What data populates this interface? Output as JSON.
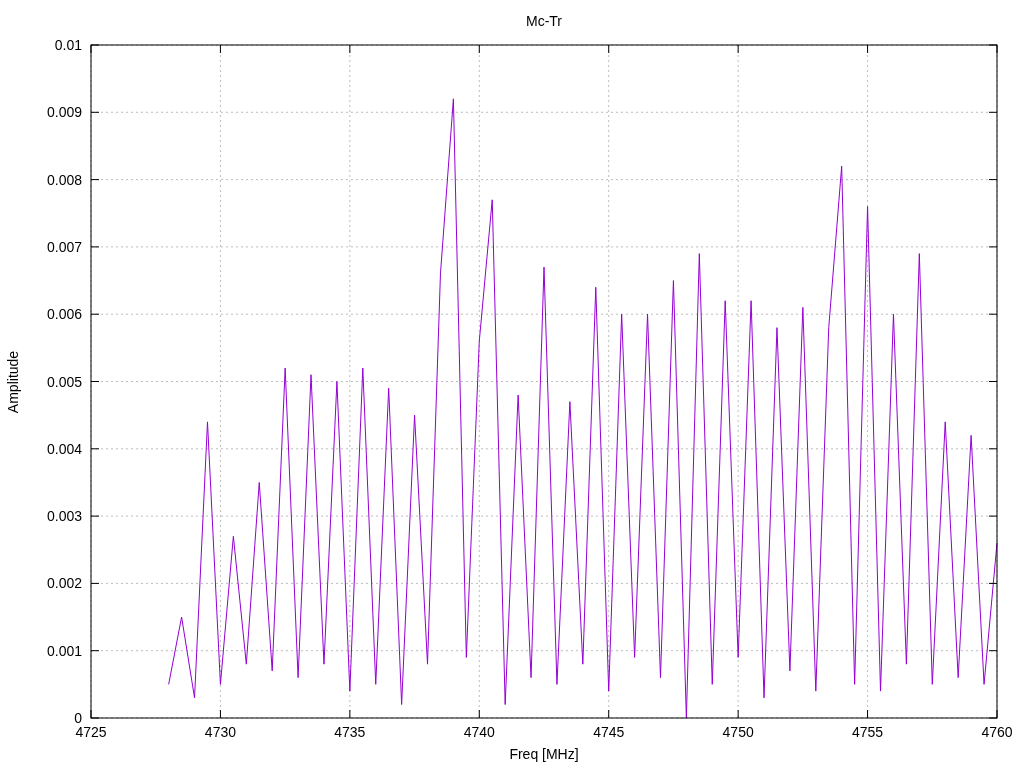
{
  "chart": {
    "chart_data": {
      "type": "line",
      "title": "Mc-Tr",
      "xlabel": "Freq [MHz]",
      "ylabel": "Amplitude",
      "xlim": [
        4725,
        4760
      ],
      "ylim": [
        0,
        0.01
      ],
      "xticks": [
        4725,
        4730,
        4735,
        4740,
        4745,
        4750,
        4755,
        4760
      ],
      "yticks": [
        {
          "value": 0,
          "label": "0"
        },
        {
          "value": 0.001,
          "label": "0.001"
        },
        {
          "value": 0.002,
          "label": "0.002"
        },
        {
          "value": 0.003,
          "label": "0.003"
        },
        {
          "value": 0.004,
          "label": "0.004"
        },
        {
          "value": 0.005,
          "label": "0.005"
        },
        {
          "value": 0.006,
          "label": "0.006"
        },
        {
          "value": 0.007,
          "label": "0.007"
        },
        {
          "value": 0.008,
          "label": "0.008"
        },
        {
          "value": 0.009,
          "label": "0.009"
        },
        {
          "value": 0.01,
          "label": "0.01"
        }
      ],
      "x": [
        4728,
        4728.5,
        4729,
        4729.5,
        4730,
        4730.5,
        4731,
        4731.5,
        4732,
        4732.5,
        4733,
        4733.5,
        4734,
        4734.5,
        4735,
        4735.5,
        4736,
        4736.5,
        4737,
        4737.5,
        4738,
        4738.5,
        4739,
        4739.5,
        4740,
        4740.5,
        4741,
        4741.5,
        4742,
        4742.5,
        4743,
        4743.5,
        4744,
        4744.5,
        4745,
        4745.5,
        4746,
        4746.5,
        4747,
        4747.5,
        4748,
        4748.5,
        4749,
        4749.5,
        4750,
        4750.5,
        4751,
        4751.5,
        4752,
        4752.5,
        4753,
        4753.5,
        4754,
        4754.5,
        4755,
        4755.5,
        4756,
        4756.5,
        4757,
        4757.5,
        4758,
        4758.5,
        4759,
        4759.5,
        4760
      ],
      "grid": true,
      "series": [
        {
          "color": "#9400d3",
          "values": [
            0.0005,
            0.0015,
            0.0003,
            0.0044,
            0.0005,
            0.0027,
            0.0008,
            0.0035,
            0.0007,
            0.0052,
            0.0006,
            0.0051,
            0.0008,
            0.005,
            0.0004,
            0.0052,
            0.0005,
            0.0049,
            0.0002,
            0.0045,
            0.0008,
            0.0066,
            0.0092,
            0.0009,
            0.0056,
            0.0077,
            0.0002,
            0.0048,
            0.0006,
            0.0067,
            0.0005,
            0.0047,
            0.0008,
            0.0064,
            0.0004,
            0.006,
            0.0009,
            0.006,
            0.0006,
            0.0065,
            0,
            0.0069,
            0.0005,
            0.0062,
            0.0009,
            0.0062,
            0.0003,
            0.0058,
            0.0007,
            0.0061,
            0.0004,
            0.0058,
            0.0082,
            0.0005,
            0.0076,
            0.0004,
            0.006,
            0.0008,
            0.0069,
            0.0005,
            0.0044,
            0.0006,
            0.0042,
            0.0005,
            0.0026
          ]
        }
      ]
    }
  }
}
